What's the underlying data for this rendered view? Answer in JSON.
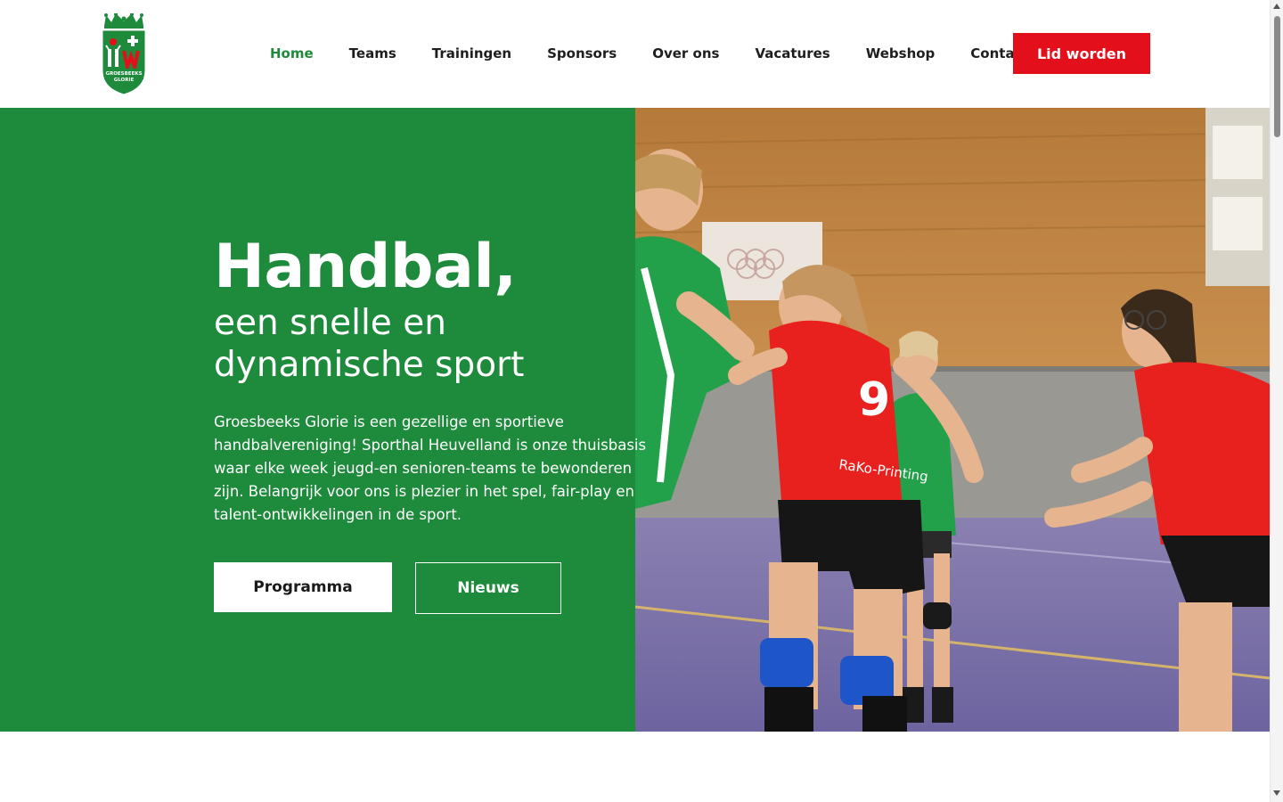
{
  "brand": {
    "name": "Groesbeeks Glorie",
    "logo_text_line1": "GROESBEEKS",
    "logo_text_line2": "GLORIE",
    "primary_color": "#1e8a3b",
    "accent_color": "#e3101c"
  },
  "nav": {
    "items": [
      {
        "label": "Home",
        "active": true
      },
      {
        "label": "Teams",
        "active": false
      },
      {
        "label": "Trainingen",
        "active": false
      },
      {
        "label": "Sponsors",
        "active": false
      },
      {
        "label": "Over ons",
        "active": false
      },
      {
        "label": "Vacatures",
        "active": false
      },
      {
        "label": "Webshop",
        "active": false
      },
      {
        "label": "Contact",
        "active": false
      }
    ],
    "cta_label": "Lid worden"
  },
  "hero": {
    "title": "Handbal,",
    "subtitle_line1": "een snelle en",
    "subtitle_line2": "dynamische sport",
    "text": "Groesbeeks Glorie is een gezellige en sportieve handbalvereniging! Sporthal Heuvelland is onze thuisbasis waar elke week jeugd-en senioren-teams te bewonderen zijn. Belangrijk voor ons is plezier in het spel, fair-play en talent-ontwikkelingen in de sport.",
    "btn_primary": "Programma",
    "btn_secondary": "Nieuws",
    "photo_jersey_number": "9",
    "photo_sponsor_text": "RaKo-Printing"
  },
  "icons": {
    "logo": "club-crest-icon",
    "scroll_up": "scroll-up-arrow-icon",
    "scroll_down": "scroll-down-arrow-icon"
  }
}
